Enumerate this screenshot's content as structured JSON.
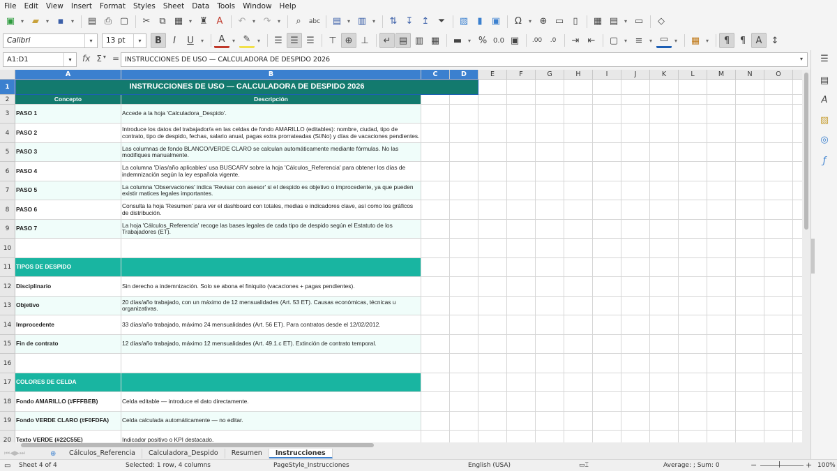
{
  "menu": [
    "File",
    "Edit",
    "View",
    "Insert",
    "Format",
    "Styles",
    "Sheet",
    "Data",
    "Tools",
    "Window",
    "Help"
  ],
  "toolbar": {
    "font_name": "Calibri",
    "font_size": "13 pt",
    "bold_label": "B",
    "italic_label": "I",
    "underline_label": "U"
  },
  "formula_bar": {
    "name_box": "A1:D1",
    "fx": "fx",
    "sigma": "Σ",
    "equals": "=",
    "content": "INSTRUCCIONES DE USO — CALCULADORA DE DESPIDO 2026"
  },
  "columns": [
    "A",
    "B",
    "C",
    "D",
    "E",
    "F",
    "G",
    "H",
    "I",
    "J",
    "K",
    "L",
    "M",
    "N",
    "O"
  ],
  "rows": {
    "r1": {
      "num": "1",
      "title": "INSTRUCCIONES DE USO — CALCULADORA DE DESPIDO 2026"
    },
    "r2": {
      "num": "2",
      "a": "Concepto",
      "b": "Descripción"
    },
    "r3": {
      "num": "3",
      "a": "PASO 1",
      "b": "Accede a la hoja 'Calculadora_Despido'."
    },
    "r4": {
      "num": "4",
      "a": "PASO 2",
      "b": "Introduce los datos del trabajador/a en las celdas de fondo AMARILLO (editables): nombre, ciudad, tipo de contrato, tipo de despido, fechas, salario anual, pagas extra prorrateadas (Sí/No) y días de vacaciones pendientes."
    },
    "r5": {
      "num": "5",
      "a": "PASO 3",
      "b": "Las columnas de fondo BLANCO/VERDE CLARO se calculan automáticamente mediante fórmulas. No las modifiques manualmente."
    },
    "r6": {
      "num": "6",
      "a": "PASO 4",
      "b": "La columna 'Días/año aplicables' usa BUSCARV sobre la hoja 'Cálculos_Referencia' para obtener los días de indemnización según la ley española vigente."
    },
    "r7": {
      "num": "7",
      "a": "PASO 5",
      "b": "La columna 'Observaciones' indica 'Revisar con asesor' si el despido es objetivo o improcedente, ya que pueden existir matices legales importantes."
    },
    "r8": {
      "num": "8",
      "a": "PASO 6",
      "b": "Consulta la hoja 'Resumen' para ver el dashboard con totales, medias e indicadores clave, así como los gráficos de distribución."
    },
    "r9": {
      "num": "9",
      "a": "PASO 7",
      "b": "La hoja 'Cálculos_Referencia' recoge las bases legales de cada tipo de despido según el Estatuto de los Trabajadores (ET)."
    },
    "r10": {
      "num": "10"
    },
    "r11": {
      "num": "11",
      "a": "TIPOS DE DESPIDO"
    },
    "r12": {
      "num": "12",
      "a": "Disciplinario",
      "b": "Sin derecho a indemnización. Solo se abona el finiquito (vacaciones + pagas pendientes)."
    },
    "r13": {
      "num": "13",
      "a": "Objetivo",
      "b": "20 días/año trabajado, con un máximo de 12 mensualidades (Art. 53 ET). Causas económicas, técnicas u organizativas."
    },
    "r14": {
      "num": "14",
      "a": "Improcedente",
      "b": "33 días/año trabajado, máximo 24 mensualidades (Art. 56 ET). Para contratos desde el 12/02/2012."
    },
    "r15": {
      "num": "15",
      "a": "Fin de contrato",
      "b": "12 días/año trabajado, máximo 12 mensualidades (Art. 49.1.c ET). Extinción de contrato temporal."
    },
    "r16": {
      "num": "16"
    },
    "r17": {
      "num": "17",
      "a": "COLORES DE CELDA"
    },
    "r18": {
      "num": "18",
      "a": "Fondo AMARILLO (#FFFBEB)",
      "b": "Celda editable — introduce el dato directamente."
    },
    "r19": {
      "num": "19",
      "a": "Fondo VERDE CLARO (#F0FDFA)",
      "b": "Celda calculada automáticamente — no editar."
    },
    "r20": {
      "num": "20",
      "a": "Texto VERDE (#22C55E)",
      "b": "Indicador positivo o KPI destacado."
    }
  },
  "sheet_tabs": [
    "Cálculos_Referencia",
    "Calculadora_Despido",
    "Resumen",
    "Instrucciones"
  ],
  "active_tab": "Instrucciones",
  "status": {
    "sheet": "Sheet 4 of 4",
    "selected": "Selected: 1 row, 4 columns",
    "page_style": "PageStyle_Instrucciones",
    "language": "English (USA)",
    "sum": "Average: ; Sum: 0",
    "zoom": "100%"
  },
  "colors": {
    "header_teal": "#137a6e",
    "section_teal": "#19b5a1",
    "mint": "#f0fdfa",
    "selection_blue": "#3b80cf"
  }
}
